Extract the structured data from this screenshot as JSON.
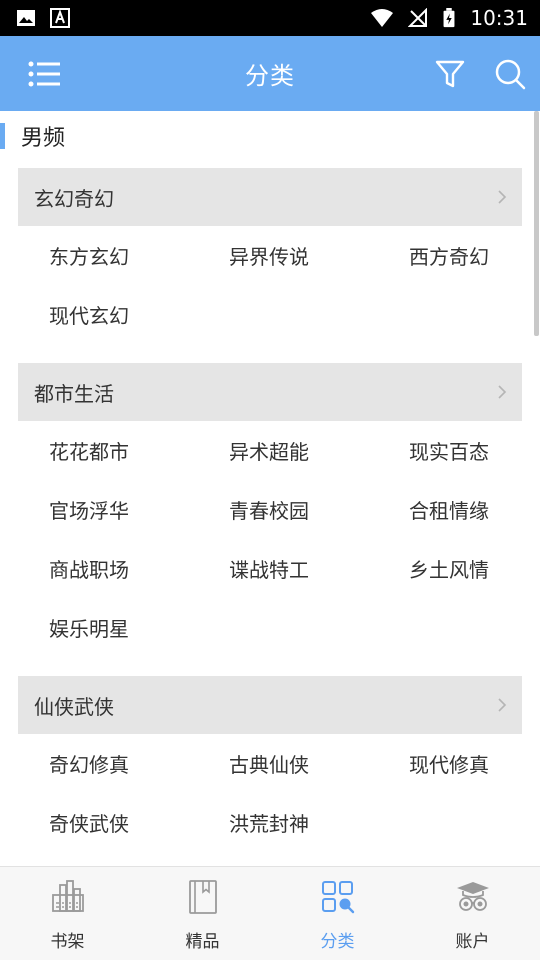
{
  "status_bar": {
    "time": "10:31"
  },
  "header": {
    "title": "分类"
  },
  "section": {
    "title": "男频"
  },
  "categories": [
    {
      "name": "玄幻奇幻",
      "items": [
        "东方玄幻",
        "异界传说",
        "西方奇幻",
        "现代玄幻"
      ]
    },
    {
      "name": "都市生活",
      "items": [
        "花花都市",
        "异术超能",
        "现实百态",
        "官场浮华",
        "青春校园",
        "合租情缘",
        "商战职场",
        "谍战特工",
        "乡土风情",
        "娱乐明星"
      ]
    },
    {
      "name": "仙侠武侠",
      "items": [
        "奇幻修真",
        "古典仙侠",
        "现代修真",
        "奇侠武侠",
        "洪荒封神"
      ]
    }
  ],
  "bottom_nav": [
    {
      "label": "书架",
      "icon": "bookshelf-icon",
      "active": false
    },
    {
      "label": "精品",
      "icon": "book-icon",
      "active": false
    },
    {
      "label": "分类",
      "icon": "category-icon",
      "active": true
    },
    {
      "label": "账户",
      "icon": "account-icon",
      "active": false
    }
  ],
  "colors": {
    "accent": "#6aabf2",
    "active_nav": "#5b9ef0",
    "category_header_bg": "#e5e5e5"
  }
}
